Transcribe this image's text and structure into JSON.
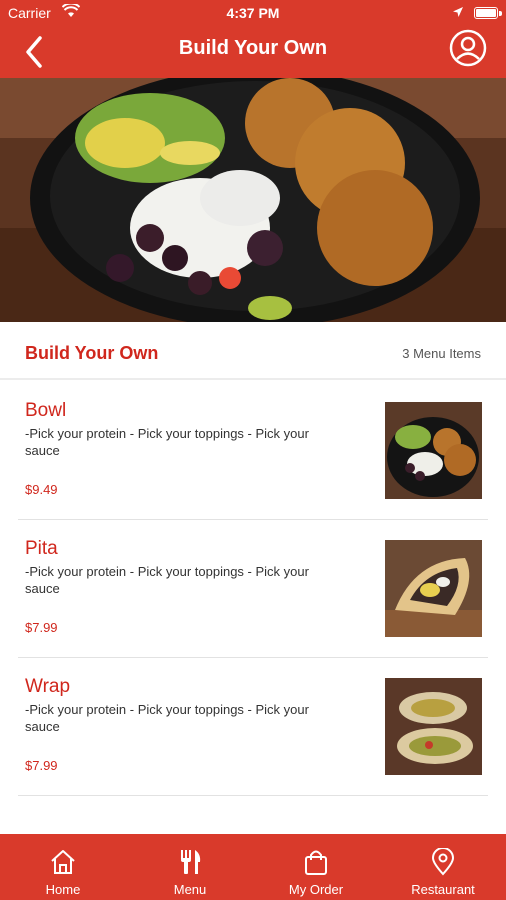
{
  "status_bar": {
    "carrier": "Carrier",
    "time": "4:37 PM",
    "wifi_icon": "wifi-icon",
    "location_icon": "location-arrow-icon",
    "battery_icon": "battery-icon"
  },
  "header": {
    "title": "Build Your Own",
    "back_icon": "chevron-left-icon",
    "profile_icon": "user-circle-icon"
  },
  "hero": {
    "image": "falafel-bowl-photo"
  },
  "section": {
    "name": "Build Your Own",
    "count": "3 Menu Items"
  },
  "items": [
    {
      "name": "Bowl",
      "description": "-Pick your protein - Pick your toppings - Pick your sauce",
      "price": "$9.49",
      "image": "bowl-photo"
    },
    {
      "name": "Pita",
      "description": "-Pick your protein - Pick your toppings - Pick your sauce",
      "price": "$7.99",
      "image": "pita-photo"
    },
    {
      "name": "Wrap",
      "description": "-Pick your protein - Pick your toppings - Pick your sauce",
      "price": "$7.99",
      "image": "wrap-photo"
    }
  ],
  "tabs": [
    {
      "label": "Home",
      "icon": "home-icon"
    },
    {
      "label": "Menu",
      "icon": "fork-knife-icon"
    },
    {
      "label": "My Order",
      "icon": "shopping-bag-icon"
    },
    {
      "label": "Restaurant",
      "icon": "map-pin-icon"
    }
  ],
  "colors": {
    "brand_red": "#d93a2b",
    "accent_red_text": "#d0271d",
    "background": "#ffffff"
  }
}
